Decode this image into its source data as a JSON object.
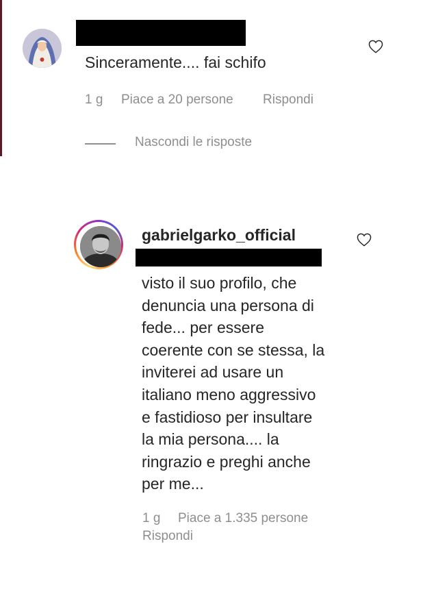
{
  "comment1": {
    "text": "Sinceramente.... fai schifo",
    "time": "1 g",
    "likes": "Piace a 20 persone",
    "reply": "Rispondi",
    "hide_replies": "Nascondi le risposte"
  },
  "comment2": {
    "username": "gabrielgarko_official",
    "text": "visto il suo profilo, che\ndenuncia una persona di\nfede... per essere\ncoerente con se stessa, la\ninviterei ad usare un\nitaliano meno aggressivo\ne fastidioso per insultare\nla mia persona.... la\nringrazio e preghi anche\nper me...",
    "time": "1 g",
    "likes": "Piace a 1.335 persone",
    "reply": "Rispondi"
  },
  "colors": {
    "text": "#262626",
    "meta": "#8e8e8e",
    "redaction": "#000000",
    "story_ring": [
      "#feda75",
      "#fa7e1e",
      "#d62976",
      "#962fbf",
      "#4f5bd5"
    ]
  },
  "icons": [
    "heart-outline-icon",
    "heart-outline-icon"
  ]
}
